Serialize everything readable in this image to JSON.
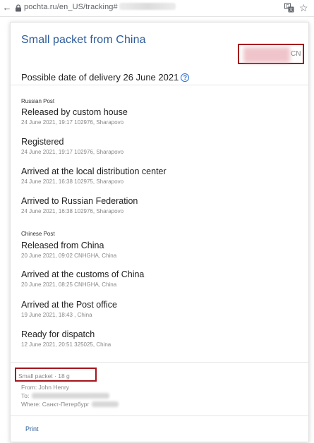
{
  "browser": {
    "url": "pochta.ru/en_US/tracking#",
    "back_icon": "back-arrow-icon",
    "lock_icon": "lock-icon",
    "translate_icon": "translate-icon",
    "star_icon": "star-icon"
  },
  "header": {
    "title": "Small packet from China",
    "tracking_suffix": "CN"
  },
  "delivery": {
    "label": "Possible date of delivery 26 June 2021",
    "help_icon": "?"
  },
  "carriers": [
    {
      "name": "Russian Post",
      "events": [
        {
          "title": "Released by custom house",
          "meta": "24 June 2021, 19:17 102976, Sharapovo"
        },
        {
          "title": "Registered",
          "meta": "24 June 2021, 19:17 102976, Sharapovo"
        },
        {
          "title": "Arrived at the local distribution center",
          "meta": "24 June 2021, 16:38 102975, Sharapovo"
        },
        {
          "title": "Arrived to Russian Federation",
          "meta": "24 June 2021, 16:38 102976, Sharapovo"
        }
      ]
    },
    {
      "name": "Chinese Post",
      "events": [
        {
          "title": "Released from China",
          "meta": "20 June 2021, 09:02 CNHGHA, China"
        },
        {
          "title": "Arrived at the customs of China",
          "meta": "20 June 2021, 08:25 CNHGHA, China"
        },
        {
          "title": "Arrived at the Post office",
          "meta": "19 June 2021, 18:43 , China"
        },
        {
          "title": "Ready for dispatch",
          "meta": "12 June 2021, 20:51 325025, China"
        }
      ]
    }
  ],
  "summary": {
    "type_weight": "Small packet  ·  18 g",
    "from": "From: John Henry",
    "to": "To:",
    "where": "Where: Санкт-Петербург"
  },
  "actions": {
    "print": "Print"
  },
  "colors": {
    "title": "#2d5b9a",
    "highlight_border": "#a6141b",
    "link": "#2d5b9a",
    "help_icon": "#2d6fd0"
  }
}
